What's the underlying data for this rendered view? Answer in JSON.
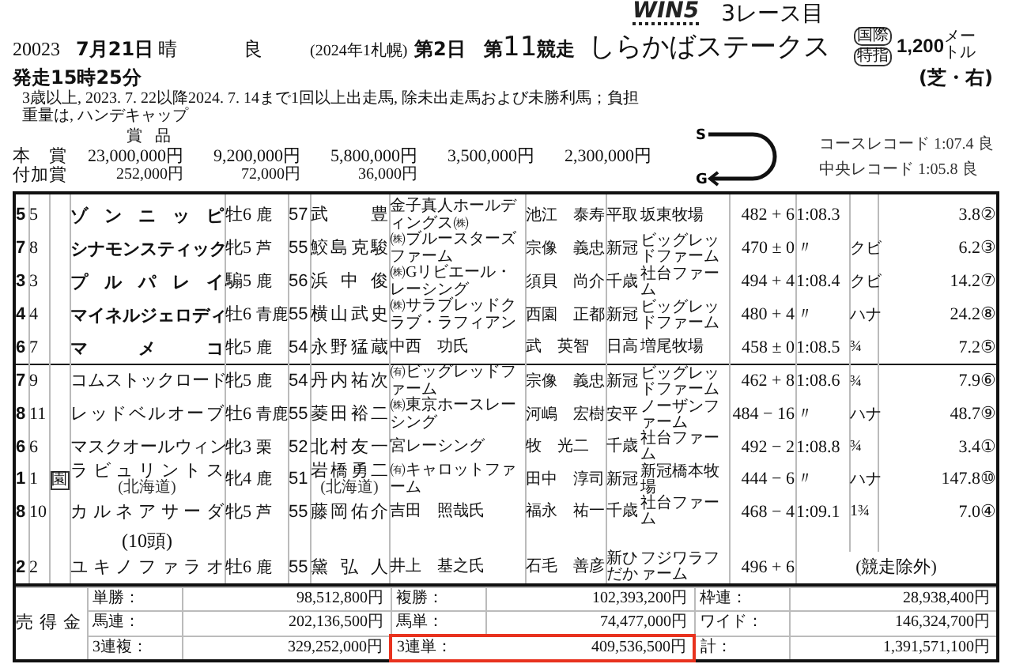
{
  "header": {
    "logo": "WIN5",
    "leg": "3レース目",
    "code": "20023",
    "date": "7月21日",
    "weather": "晴",
    "going": "良",
    "meeting": "(2024年1札幌)",
    "day": "第2日",
    "race_no": "第**11**競走",
    "race_name": "しらかばステークス",
    "badges": [
      "国際",
      "特指"
    ],
    "distance": "1,200",
    "distance_unit": "メートル",
    "surface": "(芝・右)",
    "post_time": "発走15時25分",
    "conditions": "3歳以上, 2023. 7. 22以降2024. 7. 14まで1回以上出走馬, 除未出走馬および未勝利馬；負担重量は, ハンデキャップ"
  },
  "prizes": {
    "heading": "賞品",
    "rows": [
      {
        "label": "本賞",
        "amounts": [
          "23,000,000円",
          "9,200,000円",
          "5,800,000円",
          "3,500,000円",
          "2,300,000円"
        ]
      },
      {
        "label": "付加賞",
        "amounts": [
          "252,000円",
          "72,000円",
          "36,000円"
        ]
      }
    ]
  },
  "course": {
    "start": "S",
    "goal": "G",
    "records": [
      "コースレコード 1:07.4 良",
      "中央レコード 1:05.8 良"
    ]
  },
  "results": [
    {
      "kind": "runner",
      "bold": true,
      "frame": "5",
      "number": "5",
      "horse": "ゾンニッピ",
      "sex_age": "牡6",
      "coat": "鹿",
      "weight": "57",
      "jockey": "武豊",
      "owner": "金子真人ホールディングス㈱",
      "trainer": "池江　泰寿",
      "area": "平取",
      "breeder": "坂東牧場",
      "body_weight": "482",
      "change": "+ 6",
      "time": "1:08.3",
      "odds": "3.8",
      "popularity": "②"
    },
    {
      "kind": "runner",
      "bold": true,
      "frame": "7",
      "number": "8",
      "horse": "シナモンスティック",
      "sex_age": "牝5",
      "coat": "芦",
      "weight": "55",
      "jockey": "鮫島克駿",
      "owner": "㈱ブルースターズファーム",
      "trainer": "宗像　義忠",
      "area": "新冠",
      "breeder": "ビッグレッドファーム",
      "body_weight": "470",
      "change": "± 0",
      "time": "〃",
      "margin": "クビ",
      "odds": "6.2",
      "popularity": "③"
    },
    {
      "kind": "runner",
      "bold": true,
      "frame": "3",
      "number": "3",
      "horse": "プルパレイ",
      "sex_age": "騸5",
      "coat": "鹿",
      "weight": "56",
      "jockey": "浜中俊",
      "owner": "㈱Gリビエール・レーシング",
      "trainer": "須貝　尚介",
      "area": "千歳",
      "breeder": "社台ファーム",
      "body_weight": "494",
      "change": "+ 4",
      "time": "1:08.4",
      "margin": "クビ",
      "odds": "14.2",
      "popularity": "⑦"
    },
    {
      "kind": "runner",
      "bold": true,
      "frame": "4",
      "number": "4",
      "horse": "マイネルジェロディ",
      "sex_age": "牡6",
      "coat": "青鹿",
      "weight": "55",
      "jockey": "横山武史",
      "owner": "㈱サラブレッドクラブ・ラフィアン",
      "trainer": "西園　正都",
      "area": "新冠",
      "breeder": "ビッグレッドファーム",
      "body_weight": "480",
      "change": "+ 4",
      "time": "〃",
      "margin": "ハナ",
      "odds": "24.2",
      "popularity": "⑧"
    },
    {
      "kind": "runner",
      "bold": true,
      "frame": "6",
      "number": "7",
      "horse": "マメコ",
      "sex_age": "牝5",
      "coat": "鹿",
      "weight": "54",
      "jockey": "永野猛蔵",
      "owner": "中西　功氏",
      "trainer": "武　英智",
      "area": "日高",
      "breeder": "増尾牧場",
      "body_weight": "458",
      "change": "± 0",
      "time": "1:08.5",
      "margin": "¾",
      "odds": "7.2",
      "popularity": "⑤"
    },
    {
      "kind": "runner",
      "bold": false,
      "frame": "7",
      "number": "9",
      "horse": "コムストックロード",
      "sex_age": "牝5",
      "coat": "鹿",
      "weight": "54",
      "jockey": "丹内祐次",
      "owner": "㈲ビッグレッドファーム",
      "trainer": "宗像　義忠",
      "area": "新冠",
      "breeder": "ビッグレッドファーム",
      "body_weight": "462",
      "change": "+ 8",
      "time": "1:08.6",
      "margin": "¾",
      "odds": "7.9",
      "popularity": "⑥"
    },
    {
      "kind": "runner",
      "bold": false,
      "frame": "8",
      "number": "11",
      "horse": "レッドベルオーブ",
      "sex_age": "牡6",
      "coat": "青鹿",
      "weight": "55",
      "jockey": "菱田裕二",
      "owner": "㈱東京ホースレーシング",
      "trainer": "河嶋　宏樹",
      "area": "安平",
      "breeder": "ノーザンファーム",
      "body_weight": "484",
      "change": "− 16",
      "time": "〃",
      "margin": "ハナ",
      "odds": "48.7",
      "popularity": "⑨"
    },
    {
      "kind": "runner",
      "bold": false,
      "frame": "6",
      "number": "6",
      "horse": "マスクオールウィン",
      "sex_age": "牝3",
      "coat": "栗",
      "weight": "52",
      "jockey": "北村友一",
      "owner": "宮レーシング",
      "trainer": "牧　光二",
      "area": "千歳",
      "breeder": "社台ファーム",
      "body_weight": "492",
      "change": "− 2",
      "time": "1:08.8",
      "margin": "¾",
      "odds": "3.4",
      "popularity": "①"
    },
    {
      "kind": "runner",
      "bold": false,
      "frame": "1",
      "number": "1",
      "mark": "園",
      "horse": "ラビュリントス",
      "horse_note": "(北海道)",
      "sex_age": "牝4",
      "coat": "鹿",
      "weight": "51",
      "jockey": "岩橋勇二",
      "jockey_note": "(北海道)",
      "owner": "㈲キャロットファーム",
      "trainer": "田中　淳司",
      "area": "新冠",
      "breeder": "新冠橋本牧場",
      "body_weight": "444",
      "change": "− 6",
      "time": "〃",
      "margin": "ハナ",
      "odds": "147.8",
      "popularity": "⑩"
    },
    {
      "kind": "runner",
      "bold": false,
      "frame": "8",
      "number": "10",
      "horse": "カルネアサーダ",
      "sex_age": "牝5",
      "coat": "芦",
      "weight": "55",
      "jockey": "藤岡佑介",
      "owner": "吉田　照哉氏",
      "trainer": "福永　祐一",
      "area": "千歳",
      "breeder": "社台ファーム",
      "body_weight": "468",
      "change": "− 4",
      "time": "1:09.1",
      "margin": "1¾",
      "odds": "7.0",
      "popularity": "④"
    },
    {
      "kind": "count",
      "text": "(10頭)"
    },
    {
      "kind": "runner",
      "bold": false,
      "frame": "2",
      "number": "2",
      "horse": "ユキノファラオ",
      "sex_age": "牡6",
      "coat": "鹿",
      "weight": "55",
      "jockey": "黛弘人",
      "owner": "井上　基之氏",
      "trainer": "石毛　善彦",
      "area": "新ひだか",
      "breeder": "フジワラファーム",
      "body_weight": "496",
      "change": "+ 6",
      "time": "(競走除外)"
    }
  ],
  "sales": {
    "label": "売得金",
    "items": [
      {
        "label": "単勝：",
        "value": "98,512,800円",
        "highlighted": false
      },
      {
        "label": "複勝：",
        "value": "102,393,200円",
        "highlighted": false
      },
      {
        "label": "枠連：",
        "value": "28,938,400円",
        "highlighted": false
      },
      {
        "label": "馬連：",
        "value": "202,136,500円",
        "highlighted": false
      },
      {
        "label": "馬単：",
        "value": "74,477,000円",
        "highlighted": false
      },
      {
        "label": "ワイド：",
        "value": "146,324,700円",
        "highlighted": false
      },
      {
        "label": "3連複：",
        "value": "329,252,000円",
        "highlighted": false
      },
      {
        "label": "3連単：",
        "value": "409,536,500円",
        "highlighted": true
      },
      {
        "label": "計：",
        "value": "1,391,571,100円",
        "highlighted": false
      }
    ]
  }
}
